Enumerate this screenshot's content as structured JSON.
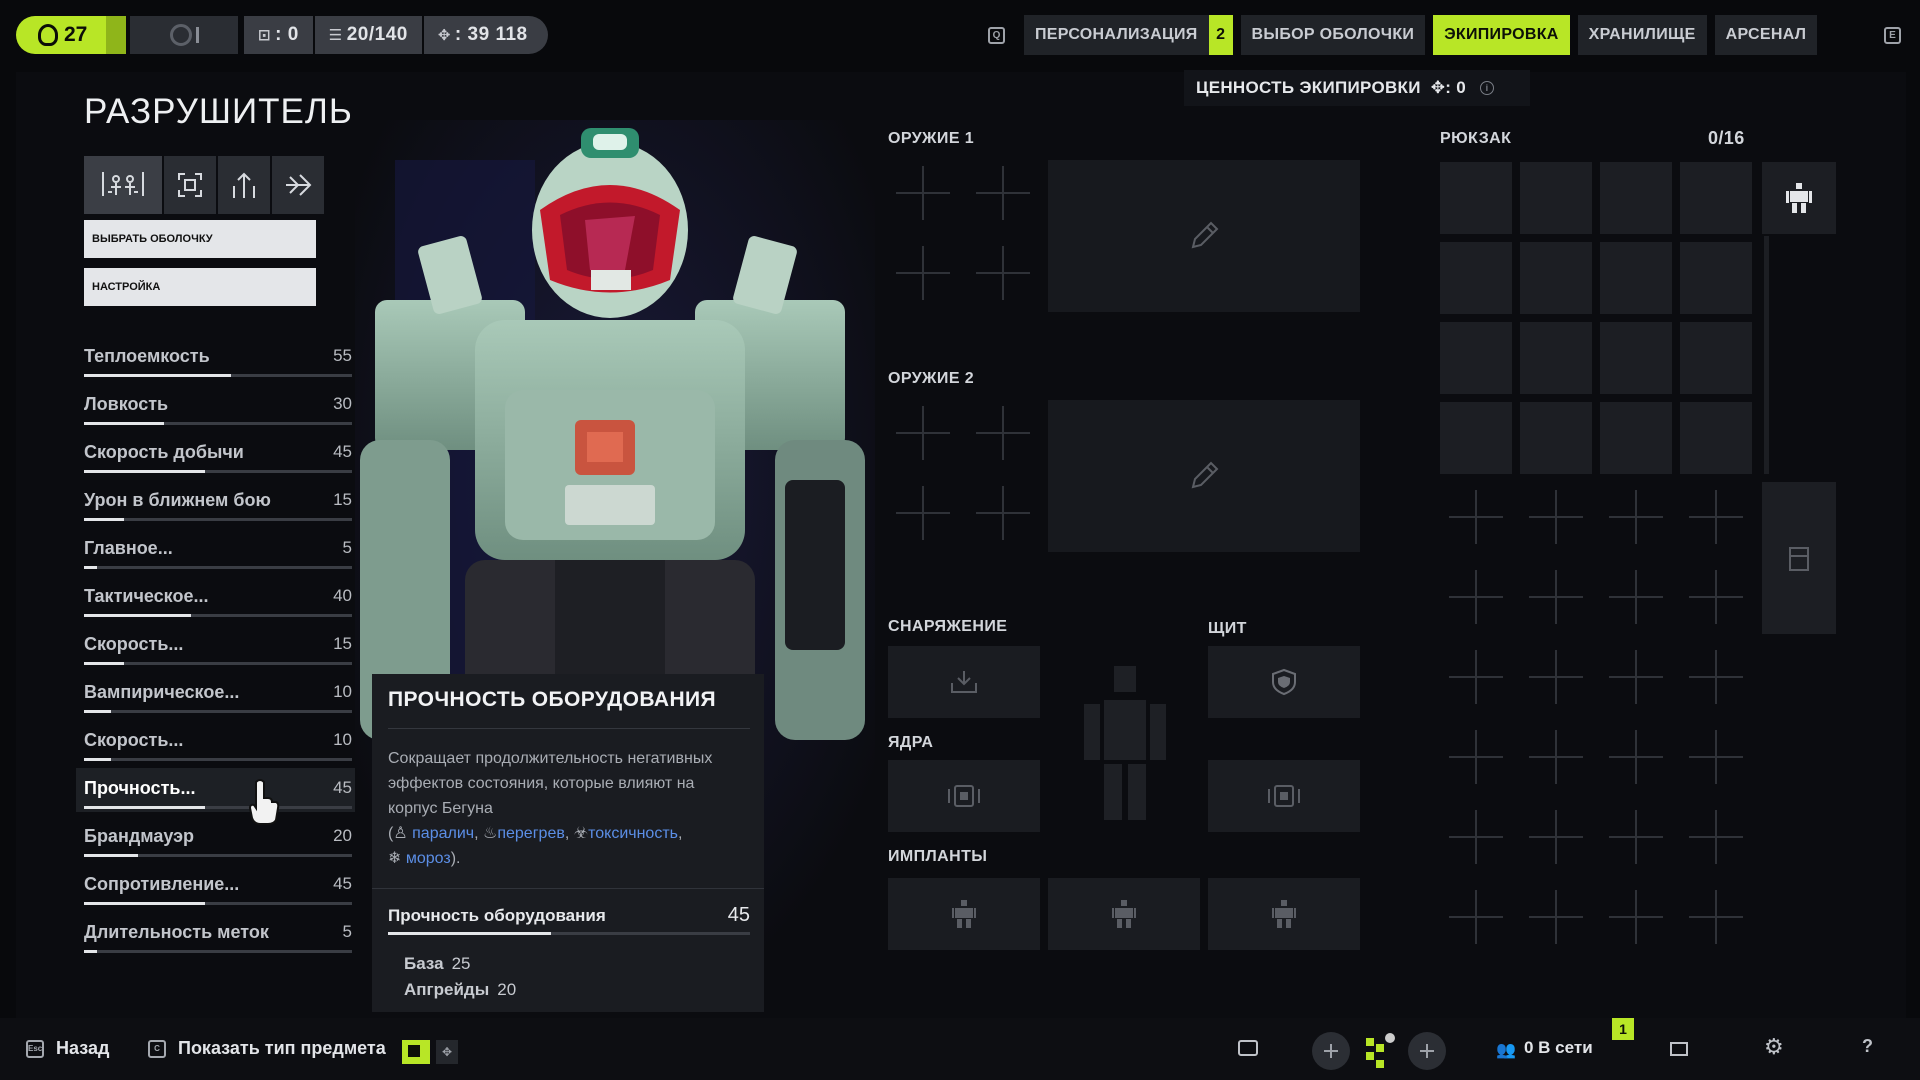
{
  "topbar": {
    "level": "27",
    "currency_a": "0",
    "capacity": "20/140",
    "credits": "39 118",
    "q_key": "Q",
    "e_key": "E",
    "tabs": [
      {
        "label": "ПЕРСОНАЛИЗАЦИЯ",
        "badge": "2"
      },
      {
        "label": "ВЫБОР ОБОЛОЧКИ"
      },
      {
        "label": "ЭКИПИРОВКА",
        "active": true
      },
      {
        "label": "ХРАНИЛИЩЕ"
      },
      {
        "label": "АРСЕНАЛ"
      }
    ],
    "accent": "#b8e626"
  },
  "shell": {
    "name": "РАЗРУШИТЕЛЬ",
    "btn_select": "ВЫБРАТЬ ОБОЛОЧКУ",
    "btn_settings": "НАСТРОЙКА"
  },
  "stats": [
    {
      "name": "Теплоемкость",
      "value": "55",
      "fraction": 0.55
    },
    {
      "name": "Ловкость",
      "value": "30",
      "fraction": 0.3
    },
    {
      "name": "Скорость добычи",
      "value": "45",
      "fraction": 0.45
    },
    {
      "name": "Урон в ближнем бою",
      "value": "15",
      "fraction": 0.15
    },
    {
      "name": "Главное...",
      "value": "5",
      "fraction": 0.05
    },
    {
      "name": "Тактическое...",
      "value": "40",
      "fraction": 0.4
    },
    {
      "name": "Скорость...",
      "value": "15",
      "fraction": 0.15
    },
    {
      "name": "Вампирическое...",
      "value": "10",
      "fraction": 0.1
    },
    {
      "name": "Скорость...",
      "value": "10",
      "fraction": 0.1
    },
    {
      "name": "Прочность...",
      "value": "45",
      "fraction": 0.45,
      "highlighted": true
    },
    {
      "name": "Брандмауэр",
      "value": "20",
      "fraction": 0.2
    },
    {
      "name": "Сопротивление...",
      "value": "45",
      "fraction": 0.45
    },
    {
      "name": "Длительность меток",
      "value": "5",
      "fraction": 0.05
    }
  ],
  "tooltip": {
    "title": "ПРОЧНОСТЬ ОБОРУДОВАНИЯ",
    "desc_text": "Сокращает продолжительность негативных эффектов состояния, которые влияют на корпус Бегуна",
    "open_paren": "(",
    "comma": ",",
    "close": ").",
    "kw_paralysis": "паралич",
    "kw_overheat": "перегрев",
    "kw_toxicity": "токсичность",
    "kw_frost": "мороз",
    "stat_label": "Прочность оборудования",
    "stat_value": "45",
    "stat_fraction": 0.45,
    "base_label": "База",
    "base_value": "25",
    "upgrades_label": "Апгрейды",
    "upgrades_value": "20"
  },
  "equipment": {
    "value_label": "ЦЕННОСТЬ ЭКИПИРОВКИ",
    "value_amount": ": 0",
    "weapon1": "ОРУЖИЕ 1",
    "weapon2": "ОРУЖИЕ 2",
    "gear": "СНАРЯЖЕНИЕ",
    "shield": "ЩИТ",
    "cores": "ЯДРА",
    "implants": "ИМПЛАНТЫ",
    "backpack": "РЮКЗАК",
    "backpack_count": "0/16"
  },
  "bottombar": {
    "back_key": "Esc",
    "back_label": "Назад",
    "show_key": "C",
    "show_label": "Показать тип предмета",
    "online": "0 В сети",
    "online_badge": "1"
  }
}
